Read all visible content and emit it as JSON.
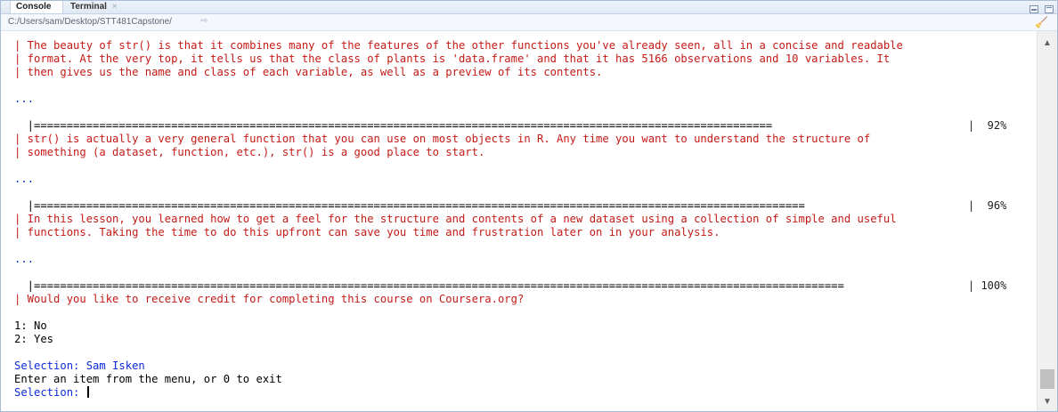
{
  "tabs": {
    "console": "Console",
    "terminal": "Terminal",
    "close": "×"
  },
  "path": {
    "text": "C:/Users/sam/Desktop/STT481Capstone/",
    "arrow": "⇨"
  },
  "console_lines": [
    {
      "text": "| The beauty of str() is that it combines many of the features of the other functions you've already seen, all in a concise and readable",
      "color": "red"
    },
    {
      "text": "| format. At the very top, it tells us that the class of plants is 'data.frame' and that it has 5166 observations and 10 variables. It",
      "color": "red"
    },
    {
      "text": "| then gives us the name and class of each variable, as well as a preview of its contents.",
      "color": "red"
    },
    {
      "text": "...",
      "color": "blue"
    },
    {
      "text": "  |=================================================================================================================",
      "color": "black",
      "pct": "|  92%"
    },
    {
      "text": "| str() is actually a very general function that you can use on most objects in R. Any time you want to understand the structure of",
      "color": "red"
    },
    {
      "text": "| something (a dataset, function, etc.), str() is a good place to start.",
      "color": "red"
    },
    {
      "text": "...",
      "color": "blue"
    },
    {
      "text": "  |======================================================================================================================",
      "color": "black",
      "pct": "|  96%"
    },
    {
      "text": "| In this lesson, you learned how to get a feel for the structure and contents of a new dataset using a collection of simple and useful",
      "color": "red"
    },
    {
      "text": "| functions. Taking the time to do this upfront can save you time and frustration later on in your analysis.",
      "color": "red"
    },
    {
      "text": "...",
      "color": "blue"
    },
    {
      "text": "  |============================================================================================================================",
      "color": "black",
      "pct": "| 100%"
    },
    {
      "text": "| Would you like to receive credit for completing this course on Coursera.org?",
      "color": "red"
    },
    {
      "text": "1: No",
      "color": "black"
    },
    {
      "text": "2: Yes",
      "color": "black"
    },
    {
      "text": "Selection: Sam Isken",
      "color": "blue"
    },
    {
      "text": "Enter an item from the menu, or 0 to exit",
      "color": "black"
    },
    {
      "text": "Selection: ",
      "color": "blue",
      "cursor": true
    }
  ],
  "colors": {
    "message_red": "#c41a16",
    "prompt_blue": "#0d2ad8",
    "pane_border": "#a9bcd6"
  }
}
